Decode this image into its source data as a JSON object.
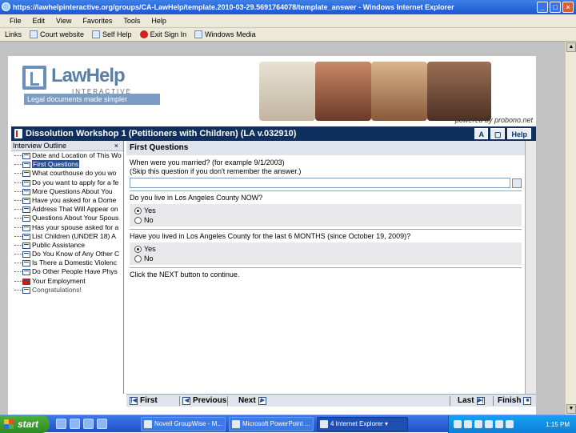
{
  "window": {
    "title": "https://lawhelpinteractive.org/groups/CA-LawHelp/template.2010-03-29.5691764078/template_answer - Windows Internet Explorer"
  },
  "menu": [
    "File",
    "Edit",
    "View",
    "Favorites",
    "Tools",
    "Help"
  ],
  "links": {
    "label": "Links",
    "items": [
      "Court website",
      "Self Help",
      "Exit Sign In",
      "Windows Media"
    ]
  },
  "banner": {
    "logo": "LawHelp",
    "sub": "INTERACTIVE",
    "tagline": "Legal documents made simpler",
    "powered": "powered by probono.net"
  },
  "workshop": {
    "title": "Dissolution Workshop 1 (Petitioners with Children) (LA v.032910)",
    "btn1": "A",
    "btn2": "Help"
  },
  "outline": {
    "title": "Interview Outline",
    "close": "×",
    "items": [
      "Date and Location of This Wo",
      "First Questions",
      "What courthouse do you wo",
      "Do you want to apply for a fe",
      "More Questions About You",
      "Have you asked for a Dome",
      "Address That Will Appear on",
      "Questions About Your Spous",
      "Has your spouse asked for a",
      "List Children (UNDER 18) A",
      "Public Assistance",
      "Do You Know of Any Other C",
      "Is There a Domestic Violenc",
      "Do Other People Have Phys",
      "Your Employment",
      "Congratulations!"
    ]
  },
  "main": {
    "heading": "First Questions",
    "q1": "When were you married? (for example 9/1/2003)",
    "q1b": "(Skip this question if you don't remember the answer.)",
    "q1_value": "",
    "q2": "Do you live in Los Angeles County NOW?",
    "q3": "Have you lived in Los Angeles County for the last 6 MONTHS (since October 19, 2009)?",
    "yes": "Yes",
    "no": "No",
    "instruction": "Click the NEXT button to continue."
  },
  "nav": {
    "first": "First",
    "previous": "Previous",
    "next": "Next",
    "last": "Last",
    "finish": "Finish"
  },
  "taskbar": {
    "start": "start",
    "tasks": [
      "Novell GroupWise - M...",
      "Microsoft PowerPoint ...",
      "4 Internet Explorer"
    ],
    "clock": "1:15 PM"
  }
}
